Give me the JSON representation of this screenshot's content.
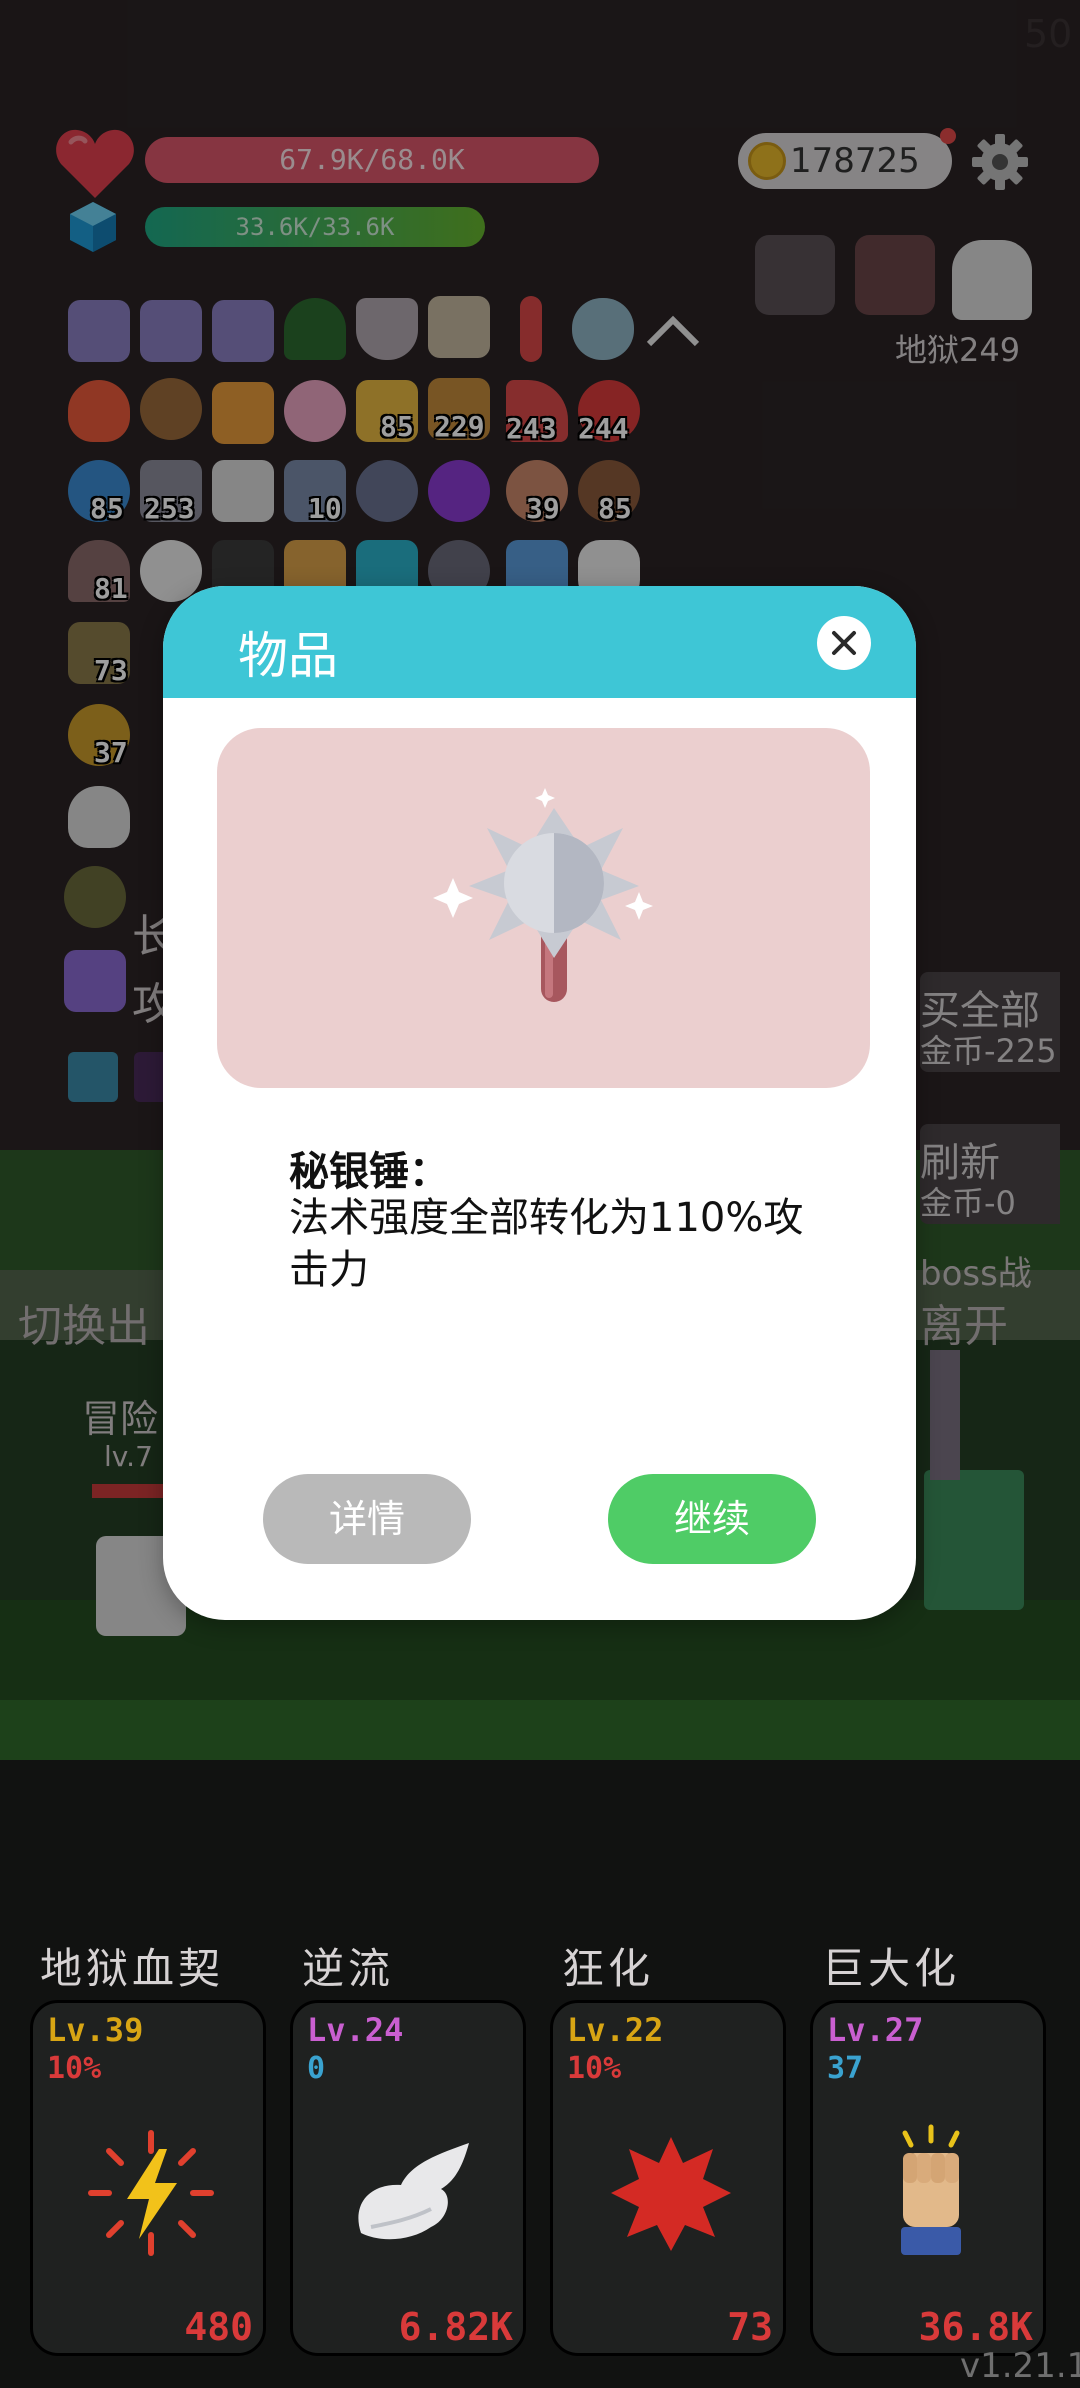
{
  "hud": {
    "fps": "50",
    "hp_text": "67.9K/68.0K",
    "mp_text": "33.6K/33.6K",
    "coins": "178725",
    "hell_level": "地狱249"
  },
  "items": {
    "counts": {
      "r2c6": "85",
      "r2c7": "229",
      "r2c8": "243",
      "r2c9": "244",
      "r3c1": "85",
      "r3c2": "253",
      "r3c4": "10",
      "r3c7": "39",
      "r3c8": "85",
      "r4c1": "81",
      "r5c1": "73",
      "r6c1": "37"
    }
  },
  "background": {
    "buy_all": "买全部",
    "buy_all_cost": "金币-225",
    "refresh": "刷新",
    "refresh_cost": "金币-0",
    "boss_fight": "boss战",
    "leave": "离开",
    "switch": "切换出",
    "adventurer": "冒险",
    "adventurer_lv": "lv.7",
    "side_char1": "长",
    "side_char2": "攻"
  },
  "modal": {
    "title": "物品",
    "item_name": "秘银锤：",
    "item_desc": "法术强度全部转化为110%攻击力",
    "detail_button": "详情",
    "continue_button": "继续"
  },
  "skills": [
    {
      "name": "地狱血契",
      "level": "Lv.39",
      "value": "10%",
      "cost": "480",
      "level_color": "#d8a514",
      "value_color": "#d93a3a"
    },
    {
      "name": "逆流",
      "level": "Lv.24",
      "value": "0",
      "cost": "6.82K",
      "level_color": "#c95fd0",
      "value_color": "#3aa3d0"
    },
    {
      "name": "狂化",
      "level": "Lv.22",
      "value": "10%",
      "cost": "73",
      "level_color": "#d8a514",
      "value_color": "#d93a3a"
    },
    {
      "name": "巨大化",
      "level": "Lv.27",
      "value": "37",
      "cost": "36.8K",
      "level_color": "#c95fd0",
      "value_color": "#3aa3d0"
    }
  ],
  "version": "v1.21.1"
}
